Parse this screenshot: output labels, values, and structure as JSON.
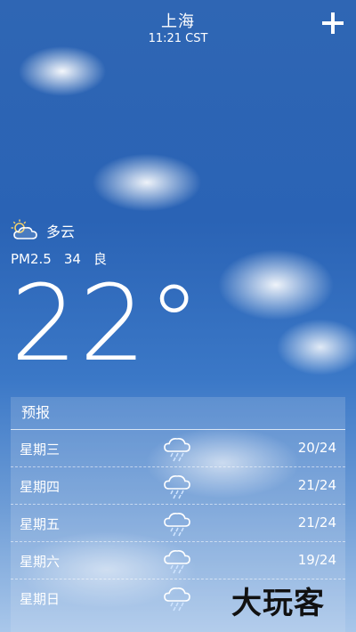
{
  "header": {
    "city": "上海",
    "time": "11:21 CST"
  },
  "current": {
    "condition": "多云",
    "condition_icon": "partly-cloudy-icon",
    "aqi_label": "PM2.5",
    "aqi_value": "34",
    "aqi_level": "良",
    "temperature": "22°"
  },
  "forecast": {
    "title": "预报",
    "days": [
      {
        "day": "星期三",
        "icon": "rain-cloud-icon",
        "range": "20/24"
      },
      {
        "day": "星期四",
        "icon": "rain-cloud-icon",
        "range": "21/24"
      },
      {
        "day": "星期五",
        "icon": "rain-cloud-icon",
        "range": "21/24"
      },
      {
        "day": "星期六",
        "icon": "rain-cloud-icon",
        "range": "19/24"
      },
      {
        "day": "星期日",
        "icon": "rain-cloud-icon",
        "range": ""
      }
    ]
  },
  "watermark": "大玩客"
}
